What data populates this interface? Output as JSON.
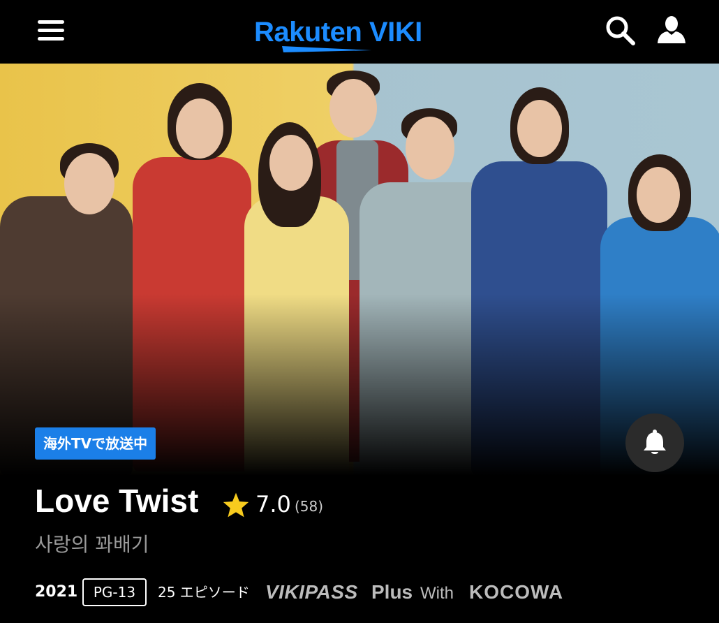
{
  "header": {
    "menu_icon": "hamburger-menu-icon",
    "logo_text": "Rakuten VIKI",
    "search_icon": "search-icon",
    "account_icon": "user-account-icon",
    "brand_color": "#1c8cff"
  },
  "hero": {
    "image_subject": "cast group photo",
    "badge_label": "海外TVで放送中",
    "badge_color": "#1b7fe8",
    "notify_icon": "bell-icon"
  },
  "show": {
    "title": "Love Twist",
    "rating_icon": "star-icon",
    "rating": "7.0",
    "rating_count": "(58)",
    "original_title": "사랑의 꽈배기",
    "year": "2021",
    "age_rating": "PG-13",
    "episodes": "25 エピソード",
    "pass_name": "VIKIPASS",
    "pass_tier": "Plus",
    "pass_with": "With",
    "partner": "KOCOWA"
  }
}
